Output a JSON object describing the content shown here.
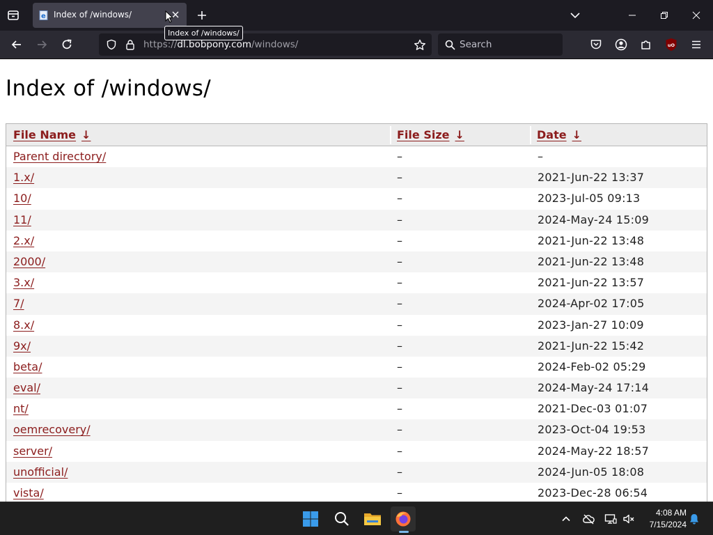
{
  "browser": {
    "tab_title": "Index of /windows/",
    "tooltip": "Index of /windows/",
    "url_prefix": "https://",
    "url_domain": "dl.bobpony.com",
    "url_path": "/windows/",
    "search_placeholder": "Search",
    "ublock_label": "uO"
  },
  "page": {
    "title": "Index of /windows/",
    "columns": [
      {
        "label": "File Name",
        "sort_arrow": "↓"
      },
      {
        "label": "File Size",
        "sort_arrow": "↓"
      },
      {
        "label": "Date",
        "sort_arrow": "↓"
      }
    ],
    "rows": [
      {
        "name": "Parent directory/",
        "size": "–",
        "date": "–"
      },
      {
        "name": "1.x/",
        "size": "–",
        "date": "2021-Jun-22 13:37"
      },
      {
        "name": "10/",
        "size": "–",
        "date": "2023-Jul-05 09:13"
      },
      {
        "name": "11/",
        "size": "–",
        "date": "2024-May-24 15:09"
      },
      {
        "name": "2.x/",
        "size": "–",
        "date": "2021-Jun-22 13:48"
      },
      {
        "name": "2000/",
        "size": "–",
        "date": "2021-Jun-22 13:48"
      },
      {
        "name": "3.x/",
        "size": "–",
        "date": "2021-Jun-22 13:57"
      },
      {
        "name": "7/",
        "size": "–",
        "date": "2024-Apr-02 17:05"
      },
      {
        "name": "8.x/",
        "size": "–",
        "date": "2023-Jan-27 10:09"
      },
      {
        "name": "9x/",
        "size": "–",
        "date": "2021-Jun-22 15:42"
      },
      {
        "name": "beta/",
        "size": "–",
        "date": "2024-Feb-02 05:29"
      },
      {
        "name": "eval/",
        "size": "–",
        "date": "2024-May-24 17:14"
      },
      {
        "name": "nt/",
        "size": "–",
        "date": "2021-Dec-03 01:07"
      },
      {
        "name": "oemrecovery/",
        "size": "–",
        "date": "2023-Oct-04 19:53"
      },
      {
        "name": "server/",
        "size": "–",
        "date": "2024-May-22 18:57"
      },
      {
        "name": "unofficial/",
        "size": "–",
        "date": "2024-Jun-05 18:08"
      },
      {
        "name": "vista/",
        "size": "–",
        "date": "2023-Dec-28 06:54"
      }
    ]
  },
  "taskbar": {
    "time": "4:08 AM",
    "date": "7/15/2024"
  },
  "colors": {
    "link": "#8b1c1c",
    "chrome_dark": "#1c1b22",
    "toolbar": "#2b2a33",
    "taskbar": "#1f1f1f"
  }
}
